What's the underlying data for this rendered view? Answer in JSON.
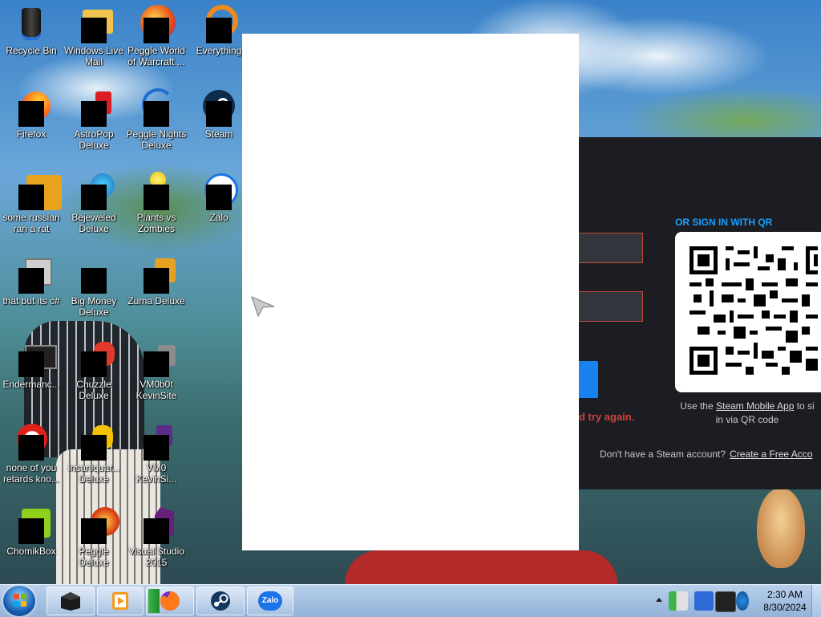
{
  "desktop": {
    "icons": [
      {
        "id": "recycle-bin",
        "label": "Recycle Bin"
      },
      {
        "id": "windows-live-mail",
        "label": "Windows Live Mail"
      },
      {
        "id": "peggle-world-of-warcraft",
        "label": "Peggle World of Warcraft ..."
      },
      {
        "id": "everything",
        "label": "Everything"
      },
      {
        "id": "firefox",
        "label": "Firefox"
      },
      {
        "id": "astropop-deluxe",
        "label": "AstroPop Deluxe"
      },
      {
        "id": "peggle-nights-deluxe",
        "label": "Peggle Nights Deluxe"
      },
      {
        "id": "steam",
        "label": "Steam"
      },
      {
        "id": "some-russian-ran-a-rat",
        "label": "some russian ran a rat"
      },
      {
        "id": "bejeweled-deluxe",
        "label": "Bejeweled Deluxe"
      },
      {
        "id": "plants-vs-zombies",
        "label": "Plants vs Zombies"
      },
      {
        "id": "zalo",
        "label": "Zalo"
      },
      {
        "id": "that-but-its-csharp",
        "label": "that but its c#"
      },
      {
        "id": "big-money-deluxe",
        "label": "Big Money Deluxe"
      },
      {
        "id": "zuma-deluxe",
        "label": "Zuma Deluxe"
      },
      {
        "id": "endermanc",
        "label": "Endermanc..."
      },
      {
        "id": "chuzzle-deluxe",
        "label": "Chuzzle Deluxe"
      },
      {
        "id": "vm0b0t-kevinsite",
        "label": "VM0b0t KevinSite"
      },
      {
        "id": "none-of-you",
        "label": "none of you retards kno..."
      },
      {
        "id": "insaniquarium-deluxe",
        "label": "Insaniquar... Deluxe"
      },
      {
        "id": "vm0-kevinsi",
        "label": "VM0 KevinSi..."
      },
      {
        "id": "chomikbox",
        "label": "ChomikBox"
      },
      {
        "id": "peggle-deluxe",
        "label": "Peggle Deluxe"
      },
      {
        "id": "visual-studio-2015",
        "label": "Visual Studio 2015"
      }
    ]
  },
  "steam_login": {
    "error_fragment": "d try again.",
    "qr_heading": "OR SIGN IN WITH QR",
    "qr_help_prefix": "Use the ",
    "qr_help_link": "Steam Mobile App",
    "qr_help_suffix": " to si",
    "qr_help_line2": "in via QR code",
    "no_account_text": "Don't have a Steam account?",
    "create_account_link": "Create a Free Acco"
  },
  "taskbar": {
    "buttons": [
      {
        "name": "taskbar-app-dark",
        "icon": "box-icon"
      },
      {
        "name": "taskbar-app-media",
        "icon": "media-player-icon"
      },
      {
        "name": "taskbar-app-firefox",
        "icon": "firefox-icon"
      },
      {
        "name": "taskbar-app-steam",
        "icon": "steam-icon"
      },
      {
        "name": "taskbar-app-zalo",
        "icon": "zalo-icon",
        "text": "Zalo"
      }
    ],
    "clock": {
      "time": "2:30 AM",
      "date": "8/30/2024"
    }
  },
  "colors": {
    "steam_accent": "#1a9fff",
    "steam_error": "#d04338",
    "steam_button": "#1a82f0",
    "steam_bg": "#1b1d22"
  }
}
